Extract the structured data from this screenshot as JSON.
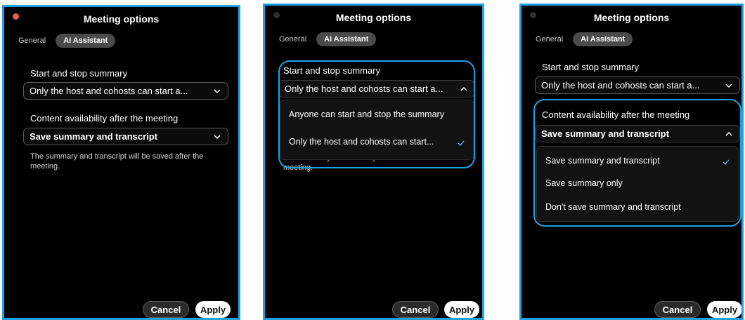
{
  "title": "Meeting options",
  "tabs": {
    "general": "General",
    "ai_assistant": "AI Assistant"
  },
  "start_stop": {
    "label": "Start and stop summary",
    "value": "Only the host and cohosts can start a...",
    "options": [
      "Anyone can start and stop the summary",
      "Only the host and cohosts can start..."
    ],
    "selected_option": "Only the host and cohosts can start..."
  },
  "content": {
    "label": "Content availability after the meeting",
    "value": "Save summary and transcript",
    "options": [
      "Save summary and transcript",
      "Save summary only",
      "Don't save summary and transcript"
    ],
    "selected_option": "Save summary and transcript"
  },
  "description": "The summary and transcript will be saved after the meeting.",
  "buttons": {
    "cancel": "Cancel",
    "apply": "Apply"
  },
  "colors": {
    "highlight": "#1da1e2",
    "background": "#000000",
    "close_dot": "#ec5c4f"
  },
  "icons": [
    "close-dot-icon",
    "chevron-down-icon",
    "chevron-up-icon",
    "checkmark-icon"
  ]
}
